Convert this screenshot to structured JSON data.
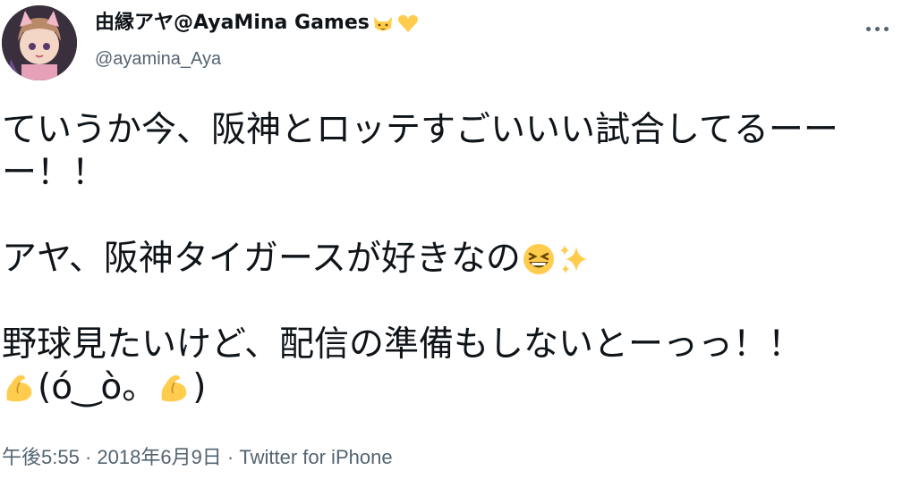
{
  "user": {
    "display_name": "由縁アヤ@AyaMina Games",
    "handle": "@ayamina_Aya",
    "name_icons": [
      "cat-face-icon",
      "yellow-heart-icon"
    ]
  },
  "tweet": {
    "line1": "ていうか今、阪神とロッテすごいいい試合してるーー",
    "line2": "ー！！",
    "line3": "アヤ、阪神タイガースが好きなの",
    "line3_icons": [
      "grinning-squinting-face-icon",
      "sparkles-icon"
    ],
    "line4": "野球見たいけど、配信の準備もしないとーっっ！！",
    "line5_text": "(ό‿ὸ。",
    "line5_close": ")",
    "line5_icons": [
      "flexed-biceps-icon",
      "flexed-biceps-icon"
    ]
  },
  "meta": {
    "time": "午後5:55",
    "sep1": " · ",
    "date": "2018年6月9日",
    "sep2": " · ",
    "source": "Twitter for iPhone"
  },
  "colors": {
    "text": "#0f1419",
    "secondary": "#536471",
    "emoji_yellow": "#ffcc4d"
  }
}
